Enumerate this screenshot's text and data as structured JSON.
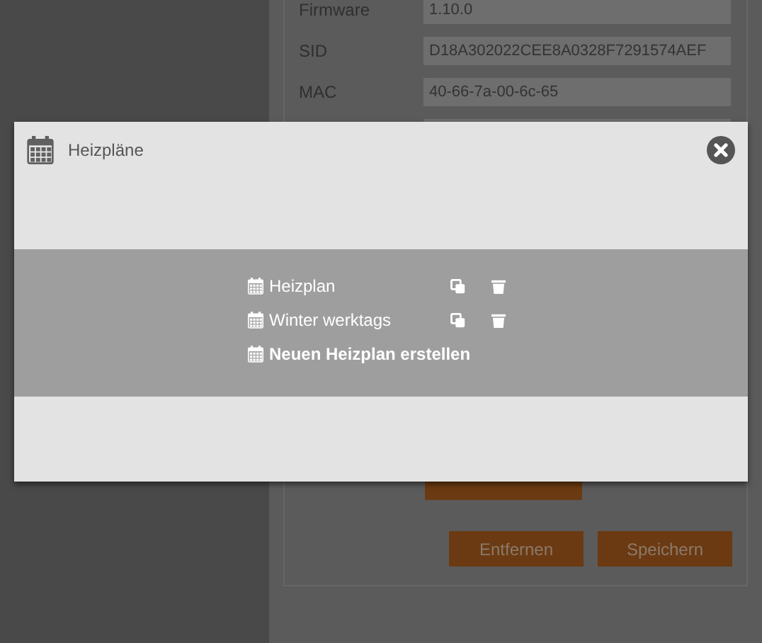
{
  "background_form": {
    "fields": [
      {
        "label": "Firmware",
        "value": "1.10.0"
      },
      {
        "label": "SID",
        "value": "D18A302022CEE8A0328F7291574AEF"
      },
      {
        "label": "MAC",
        "value": "40-66-7a-00-6c-65"
      }
    ],
    "buttons": [
      "Entfernen",
      "Speichern"
    ]
  },
  "dialog": {
    "title": "Heizpläne",
    "plans": [
      {
        "name": "Heizplan",
        "kind": "plan"
      },
      {
        "name": "Winter werktags",
        "kind": "plan"
      },
      {
        "name": "Neuen Heizplan erstellen",
        "kind": "create"
      }
    ]
  }
}
